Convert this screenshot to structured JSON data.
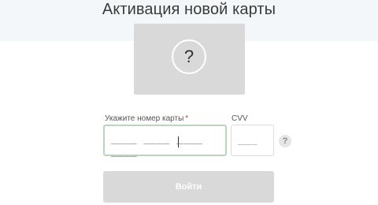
{
  "header": {
    "title": "Активация новой карты"
  },
  "card_preview": {
    "icon": "question-mark-icon",
    "symbol": "?"
  },
  "form": {
    "card_number": {
      "label": "Укажите номер карты",
      "required_mark": "*",
      "placeholder": "____ ____ ____ ____"
    },
    "cvv": {
      "label": "CVV",
      "placeholder": "___"
    },
    "help": {
      "icon": "help-icon",
      "symbol": "?"
    },
    "submit_label": "Войти"
  },
  "colors": {
    "header_band": "#f3f7f9",
    "card_placeholder": "#d9d9d9",
    "active_input_border": "#b9d6bd",
    "required_mark": "#d0432f",
    "button_disabled": "#d9d9d9"
  }
}
